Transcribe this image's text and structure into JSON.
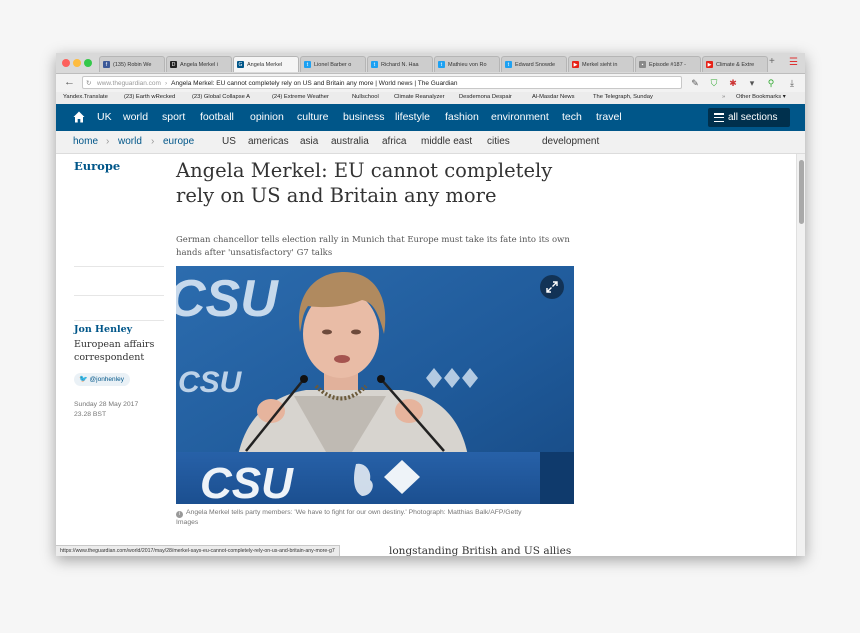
{
  "browser": {
    "tabs": [
      {
        "label": "(135) Robin We",
        "icon": "facebook-icon",
        "color": "#3b5998",
        "glyph": "f"
      },
      {
        "label": "Angela Merkel i",
        "icon": "dictionary-icon",
        "color": "#222222",
        "glyph": "D"
      },
      {
        "label": "Angela Merkel",
        "icon": "guardian-icon",
        "color": "#005689",
        "glyph": "G"
      },
      {
        "label": "Lionel Barber o",
        "icon": "twitter-icon",
        "color": "#1da1f2",
        "glyph": "t"
      },
      {
        "label": "Richard N. Haa",
        "icon": "twitter-icon",
        "color": "#1da1f2",
        "glyph": "t"
      },
      {
        "label": "Mathieu von Ro",
        "icon": "twitter-icon",
        "color": "#1da1f2",
        "glyph": "t"
      },
      {
        "label": "Edward Snowde",
        "icon": "twitter-icon",
        "color": "#1da1f2",
        "glyph": "t"
      },
      {
        "label": "Merkel sieht in",
        "icon": "youtube-icon",
        "color": "#e62117",
        "glyph": "▶"
      },
      {
        "label": "Episode #187 -",
        "icon": "page-icon",
        "color": "#888888",
        "glyph": "▪"
      },
      {
        "label": "Climate & Extre",
        "icon": "youtube-icon",
        "color": "#e62117",
        "glyph": "▶"
      }
    ],
    "active_tab": 2,
    "url_host": "www.theguardian.com",
    "url_title": "Angela Merkel: EU cannot completely rely on US and Britain any more | World news | The Guardian",
    "bookmarks": [
      "Yandex.Translate",
      "(23) Earth wRecked",
      "(23) Global Collapse A",
      "(24) Extreme Weather",
      "Nullschool",
      "Climate Reanalyzer",
      "Desdemona Despair",
      "Al-Masdar News",
      "The Telegraph, Sunday"
    ],
    "other_bookmarks": "Other Bookmarks ▾",
    "status_url": "https://www.theguardian.com/world/2017/may/28/merkel-says-eu-cannot-completely-rely-on-us-and-britain-any-more-g7"
  },
  "guardian_nav": {
    "items": [
      "UK",
      "world",
      "sport",
      "football",
      "opinion",
      "culture",
      "business",
      "lifestyle",
      "fashion",
      "environment",
      "tech",
      "travel"
    ],
    "all_sections": "all sections"
  },
  "subnav": {
    "crumbs": [
      "home",
      "world",
      "europe"
    ],
    "links": [
      "US",
      "americas",
      "asia",
      "australia",
      "africa",
      "middle east",
      "cities",
      "development"
    ]
  },
  "article": {
    "section": "Europe",
    "headline_line1": "Angela Merkel: EU cannot completely",
    "headline_line2": "rely on US and Britain any more",
    "standfirst": "German chancellor tells election rally in Munich that Europe must take its fate into its own hands after 'unsatisfactory' G7 talks",
    "author": "Jon Henley",
    "role": "European affairs correspondent",
    "twitter": "@jonhenley",
    "date": "Sunday 28 May 2017",
    "time": "23.28 BST",
    "photo_text_back": "CSU",
    "photo_text_front": "CSU",
    "caption": "Angela Merkel tells party members: 'We have to fight for our own destiny.' Photograph: Matthias Balk/AFP/Getty Images",
    "body_snippet": "longstanding British and US allies"
  },
  "colors": {
    "guardian_blue": "#005689",
    "guardian_dark": "#00304d"
  }
}
